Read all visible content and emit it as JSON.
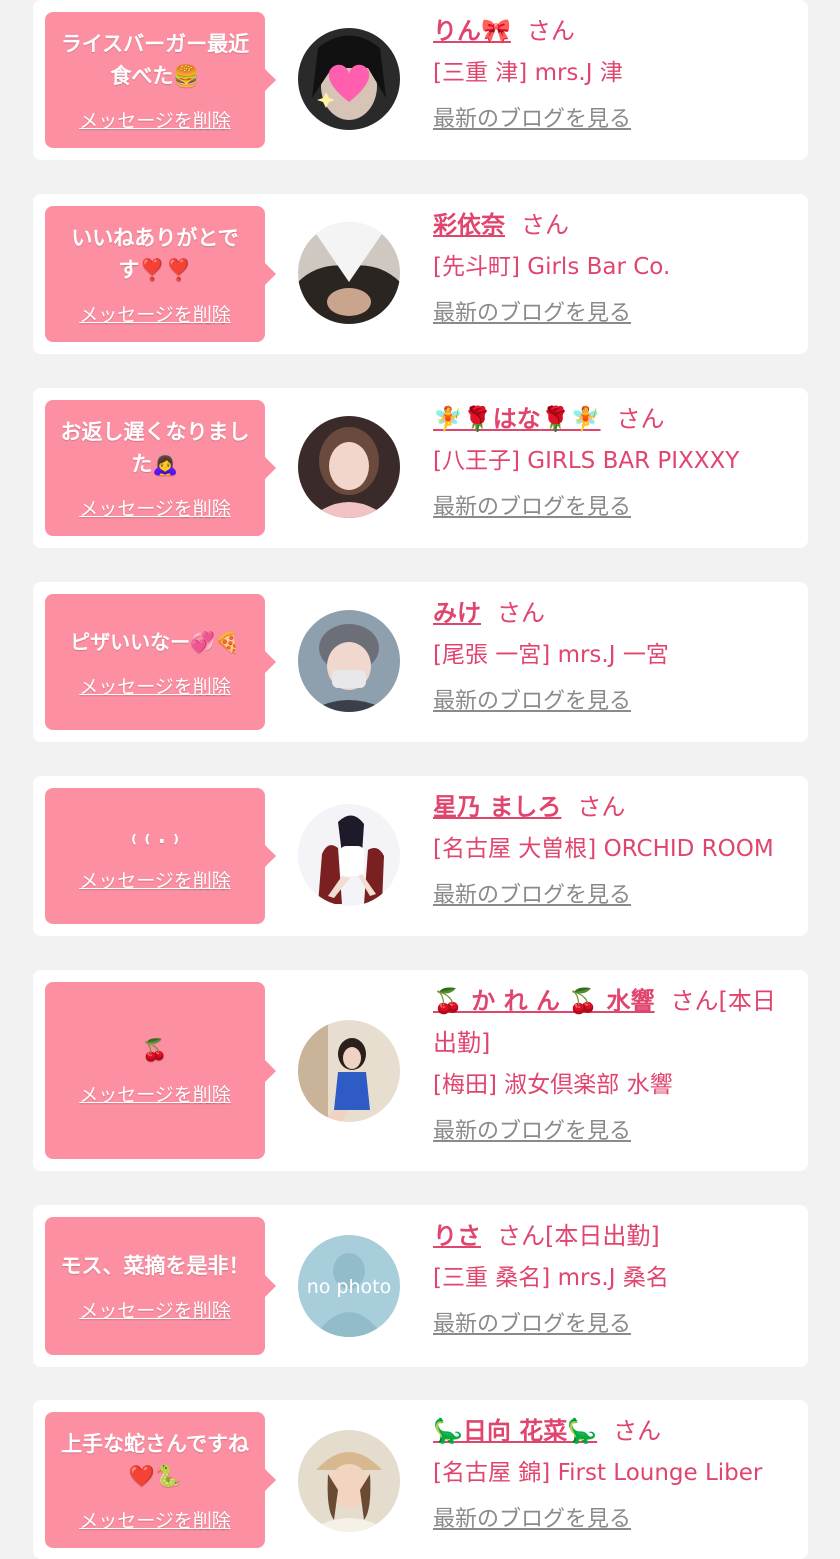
{
  "items": [
    {
      "message": "ライスバーガー最近食べた🍔",
      "delete_label": "メッセージを削除",
      "name": "りん🎀",
      "honorific": "さん",
      "shop": "[三重 津] mrs.J 津",
      "blog_link": "最新のブログを見る",
      "avatar_icon": "heart-sparkle-photo"
    },
    {
      "message": "いいねありがとです❣️❣️",
      "delete_label": "メッセージを削除",
      "name": "彩依奈",
      "honorific": "さん",
      "shop": "[先斗町] Girls Bar Co.",
      "blog_link": "最新のブログを見る",
      "avatar_icon": "portrait-photo"
    },
    {
      "message": "お返し遅くなりました🙇‍♀️",
      "delete_label": "メッセージを削除",
      "name_prefix": "🧚🌹",
      "name": "はな",
      "name_suffix": "🌹🧚",
      "honorific": "さん",
      "shop": "[八王子] GIRLS BAR PIXXXY",
      "blog_link": "最新のブログを見る",
      "avatar_icon": "portrait-photo"
    },
    {
      "message": "ピザいいなー💞🍕",
      "delete_label": "メッセージを削除",
      "name": "みけ",
      "honorific": "さん",
      "shop": "[尾張 一宮] mrs.J 一宮",
      "blog_link": "最新のブログを見る",
      "avatar_icon": "portrait-photo"
    },
    {
      "message": "₍ ₍ . ₎",
      "delete_label": "メッセージを削除",
      "name": "星乃 ましろ",
      "honorific": "さん",
      "shop": "[名古屋 大曽根] ORCHID ROOM",
      "blog_link": "最新のブログを見る",
      "avatar_icon": "portrait-photo"
    },
    {
      "message": "🍒",
      "delete_label": "メッセージを削除",
      "name": "🍒 か れ ん 🍒 水響",
      "honorific": "さん[本日出勤]",
      "shop": "[梅田] 淑女倶楽部 水響",
      "blog_link": "最新のブログを見る",
      "avatar_icon": "portrait-photo"
    },
    {
      "message": "モス、菜摘を是非！",
      "delete_label": "メッセージを削除",
      "name": "りさ",
      "honorific": "さん[本日出勤]",
      "shop": "[三重 桑名] mrs.J 桑名",
      "blog_link": "最新のブログを見る",
      "avatar_icon": "no-photo-placeholder",
      "avatar_text": "no photo"
    },
    {
      "message": "上手な蛇さんですね❤️🐍",
      "delete_label": "メッセージを削除",
      "name": "🦕日向 花菜🦕",
      "honorific": "さん",
      "shop": "[名古屋 錦] First Lounge Liber",
      "blog_link": "最新のブログを見る",
      "avatar_icon": "portrait-photo"
    }
  ],
  "colors": {
    "bubble": "#fd8fa2",
    "accent": "#e0456e",
    "background": "#f2f2f2",
    "link_gray": "#8a8a8a"
  }
}
